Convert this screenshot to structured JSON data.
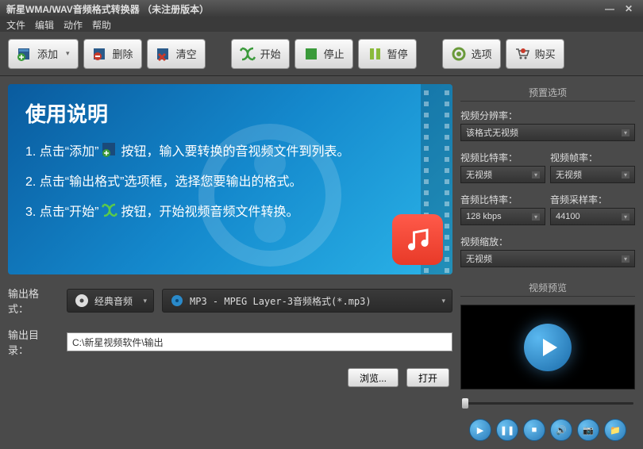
{
  "titlebar": {
    "title": "新星WMA/WAV音频格式转换器  （未注册版本）"
  },
  "menu": {
    "file": "文件",
    "edit": "编辑",
    "action": "动作",
    "help": "帮助"
  },
  "toolbar": {
    "add": "添加",
    "delete": "删除",
    "clear": "清空",
    "start": "开始",
    "stop": "停止",
    "pause": "暂停",
    "options": "选项",
    "buy": "购买"
  },
  "banner": {
    "title": "使用说明",
    "step1a": "1. 点击“添加”",
    "step1b": "按钮，输入要转换的音视频文件到列表。",
    "step2": "2. 点击“输出格式”选项框，选择您要输出的格式。",
    "step3a": "3. 点击“开始”",
    "step3b": "按钮，开始视频音频文件转换。"
  },
  "output": {
    "format_label": "输出格式：",
    "category": "经典音频",
    "format": "MP3 - MPEG Layer-3音频格式(*.mp3)",
    "dir_label": "输出目录：",
    "dir_value": "C:\\新星视频软件\\输出",
    "browse": "浏览...",
    "open": "打开"
  },
  "preset": {
    "panel_title": "预置选项",
    "resolution_label": "视频分辨率：",
    "resolution": "该格式无视频",
    "vbitrate_label": "视频比特率：",
    "vbitrate": "无视频",
    "vfps_label": "视频帧率：",
    "vfps": "无视频",
    "abitrate_label": "音频比特率：",
    "abitrate": "128 kbps",
    "asample_label": "音频采样率：",
    "asample": "44100",
    "vzoom_label": "视频缩放：",
    "vzoom": "无视频"
  },
  "preview": {
    "panel_title": "视频预览"
  }
}
